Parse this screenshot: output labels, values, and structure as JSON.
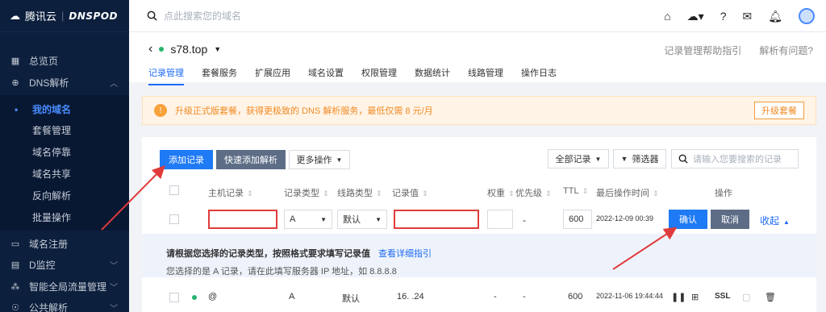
{
  "brand": {
    "logo_text": "腾讯云",
    "product": "DNSPOD"
  },
  "sidebar": {
    "items": [
      {
        "label": "总览页",
        "icon": "grid-icon"
      },
      {
        "label": "DNS解析",
        "icon": "globe-icon",
        "expanded": true
      },
      {
        "label": "域名注册",
        "icon": "monitor-icon"
      },
      {
        "label": "D监控",
        "icon": "chart-icon"
      },
      {
        "label": "智能全局流量管理",
        "icon": "traffic-icon"
      },
      {
        "label": "公共解析",
        "icon": "public-icon"
      }
    ],
    "sub_items": [
      "我的域名",
      "套餐管理",
      "域名停靠",
      "域名共享",
      "反向解析",
      "批量操作"
    ]
  },
  "topbar": {
    "search_placeholder": "点此搜索您的域名"
  },
  "header": {
    "domain": "s78.top",
    "help_link": "记录管理帮助指引",
    "question_link": "解析有问题?",
    "tabs": [
      "记录管理",
      "套餐服务",
      "扩展应用",
      "域名设置",
      "权限管理",
      "数据统计",
      "线路管理",
      "操作日志"
    ],
    "active_tab": "记录管理"
  },
  "banner": {
    "text": "升级正式版套餐，获得更极致的 DNS 解析服务，最低仅需 8 元/月",
    "button": "升级套餐"
  },
  "toolbar": {
    "add_record": "添加记录",
    "quick_add": "快速添加解析",
    "more_ops": "更多操作",
    "all_records": "全部记录",
    "filter": "筛选器",
    "search_placeholder": "请输入您要搜索的记录"
  },
  "table": {
    "headers": [
      "主机记录",
      "记录类型",
      "线路类型",
      "记录值",
      "权重",
      "优先级",
      "TTL",
      "最后操作时间",
      "操作"
    ],
    "edit_row": {
      "host": "",
      "type": "A",
      "line": "默认",
      "value": "",
      "weight": "",
      "priority": "-",
      "ttl": "600",
      "time": "2022-12-09 00:39",
      "confirm": "确认",
      "cancel": "取消",
      "collapse": "收起"
    },
    "hint": {
      "title": "请根据您选择的记录类型，按照格式要求填写记录值",
      "link": "查看详细指引",
      "detail": "您选择的是 A 记录，请在此填写服务器 IP 地址，如 8.8.8.8"
    },
    "rows": [
      {
        "host": "@",
        "type": "A",
        "line": "默认",
        "value": "16.      .24",
        "weight": "-",
        "priority": "-",
        "ttl": "600",
        "time": "2022-11-06 19:44:44",
        "ssl": "SSL"
      }
    ]
  }
}
